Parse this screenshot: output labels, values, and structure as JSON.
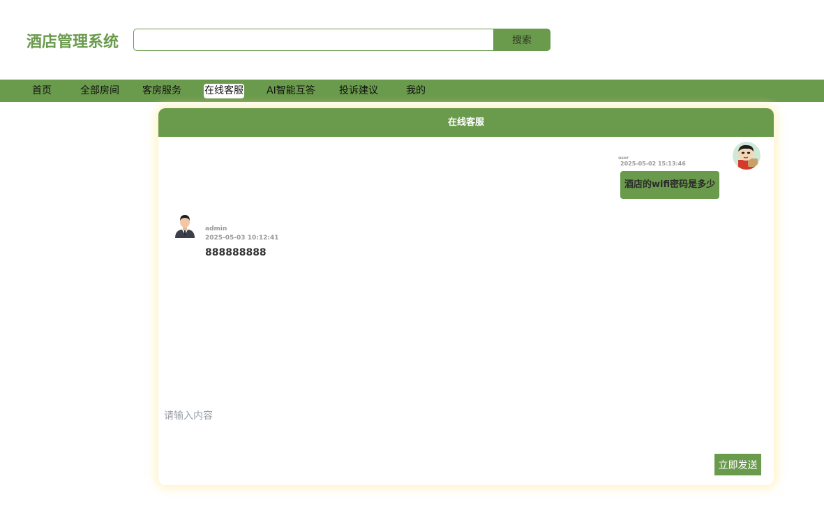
{
  "header": {
    "brand": "酒店管理系统",
    "search": {
      "value": "",
      "placeholder": "",
      "button_label": "搜索"
    }
  },
  "nav": {
    "items": [
      {
        "label": "首页"
      },
      {
        "label": "全部房间"
      },
      {
        "label": "客房服务"
      },
      {
        "label": "在线客服",
        "active": true
      },
      {
        "label": "AI智能互答"
      },
      {
        "label": "投诉建议"
      },
      {
        "label": "我的"
      }
    ]
  },
  "chat": {
    "title": "在线客服",
    "messages": [
      {
        "sender": "user",
        "time": "2025-05-02 15:13:46",
        "text": "酒店的wifi密码是多少",
        "avatar": "cartoon-boy-avatar"
      },
      {
        "sender": "admin",
        "time": "2025-05-03 10:12:41",
        "text": "888888888",
        "avatar": "businessman-avatar"
      }
    ],
    "compose": {
      "placeholder": "请输入内容",
      "value": ""
    },
    "send_label": "立即发送"
  },
  "colors": {
    "accent": "#6a9a4c",
    "panel_glow": "#ffecaa"
  }
}
